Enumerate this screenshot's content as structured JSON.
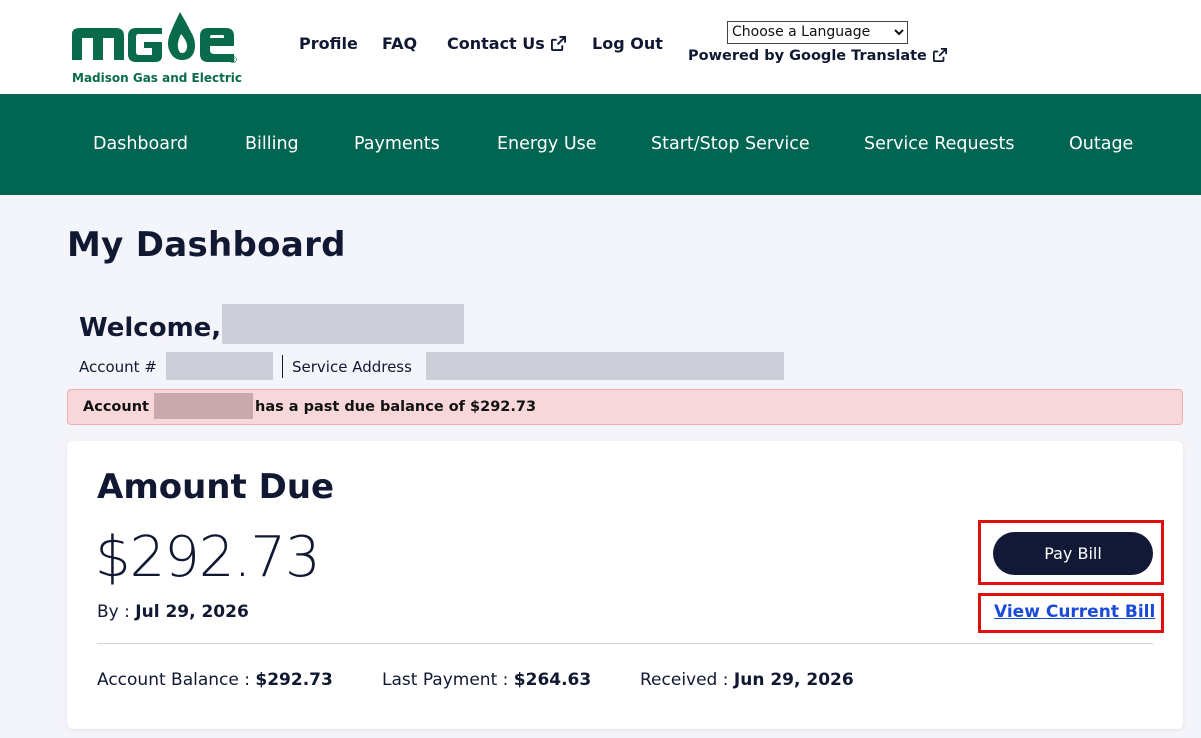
{
  "brand": {
    "logo_text": "MGE",
    "registered_mark": "®",
    "tagline": "Madison Gas and Electric",
    "color": "#0a6b4c"
  },
  "header": {
    "links": [
      {
        "label": "Profile"
      },
      {
        "label": "FAQ"
      },
      {
        "label": "Contact Us",
        "icon": "external-link-icon"
      },
      {
        "label": "Log Out"
      }
    ],
    "language_select": {
      "value": "Choose a Language"
    },
    "powered_by": "Powered by Google Translate",
    "powered_by_icon": "external-link-icon"
  },
  "nav": {
    "background": "#006652",
    "items": [
      {
        "label": "Dashboard"
      },
      {
        "label": "Billing"
      },
      {
        "label": "Payments"
      },
      {
        "label": "Energy Use"
      },
      {
        "label": "Start/Stop Service"
      },
      {
        "label": "Service Requests"
      },
      {
        "label": "Outage"
      }
    ]
  },
  "main": {
    "title": "My Dashboard",
    "welcome_prefix": "Welcome,",
    "account_label": "Account #",
    "service_address_label": "Service Address",
    "alert": {
      "prefix": "Account",
      "suffix": "has a past due balance of $292.73",
      "background": "#f8d7da"
    },
    "amount_card": {
      "title": "Amount Due",
      "amount": "$292.73",
      "due_label": "By :",
      "due_date": "Jul 29, 2026",
      "pay_button": "Pay Bill",
      "view_bill_link": "View Current Bill",
      "account_balance_label": "Account Balance :",
      "account_balance": "$292.73",
      "last_payment_label": "Last Payment :",
      "last_payment": "$264.63",
      "received_label": "Received :",
      "received_date": "Jun 29, 2026",
      "highlight_color": "#e01010"
    }
  }
}
